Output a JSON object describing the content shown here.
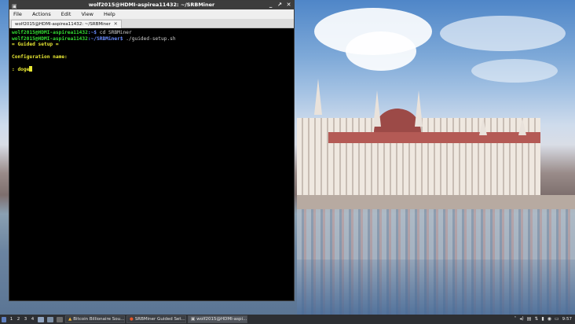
{
  "window": {
    "title": "wolf2015@HDMI-aspirea11432: ~/SRBMiner",
    "menu": [
      "File",
      "Actions",
      "Edit",
      "View",
      "Help"
    ],
    "tab_title": "wolf2015@HDMI-aspirea11432: ~/SRBMiner",
    "controls": {
      "minimize": "_",
      "maximize": "↗",
      "close": "✕"
    }
  },
  "terminal": {
    "line1": {
      "prompt_user": "wolf2015@HDMI-aspirea11432",
      "prompt_path": ":~$",
      "command": " cd SRBMiner"
    },
    "line2": {
      "prompt_user": "wolf2015@HDMI-aspirea11432",
      "prompt_path": ":~/SRBMiner$",
      "command": " ./guided-setup.sh"
    },
    "line3": "= Guided setup =",
    "line4": "Configuration name:",
    "line5_prefix": ": ",
    "line5_input": "doge"
  },
  "taskbar": {
    "workspaces": [
      "1",
      "2",
      "3",
      "4"
    ],
    "tasks": [
      {
        "label": "Bitcoin Billionaire Sou...",
        "icon": "warning-icon"
      },
      {
        "label": "SRBMiner Guided Set...",
        "icon": "browser-icon"
      },
      {
        "label": "wolf2015@HDMI-aspi...",
        "icon": "terminal-icon"
      }
    ],
    "clock": "9:57"
  },
  "colors": {
    "prompt_user": "#33dd33",
    "prompt_path": "#6a8cff",
    "heading": "#e8e833"
  }
}
